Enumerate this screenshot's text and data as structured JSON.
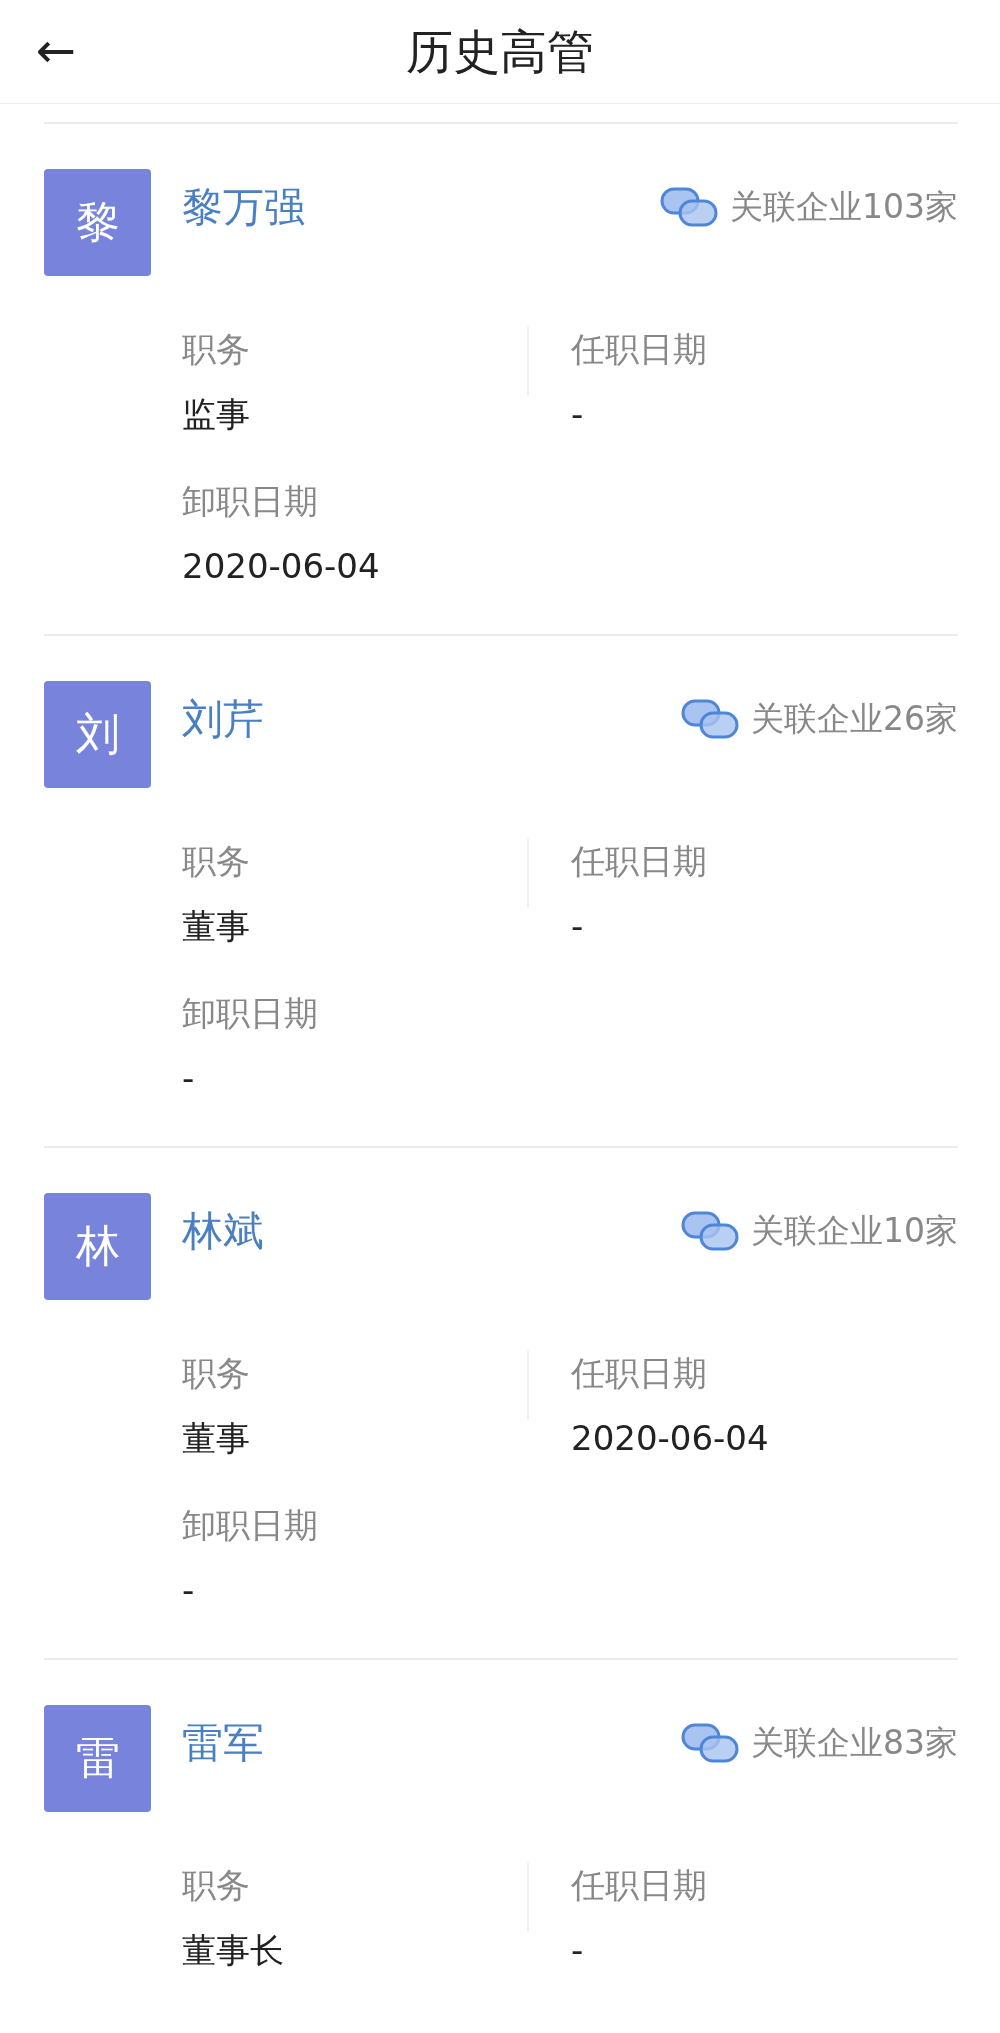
{
  "header": {
    "back": "←",
    "title": "历史高管"
  },
  "people": [
    {
      "avatar": "黎",
      "name": "黎万强",
      "related": "关联企业103家",
      "fields": [
        {
          "label": "职务",
          "value": "监事"
        },
        {
          "label": "任职日期",
          "value": "-"
        },
        {
          "label": "卸职日期",
          "value": "2020-06-04"
        }
      ]
    },
    {
      "avatar": "刘",
      "name": "刘芹",
      "related": "关联企业26家",
      "fields": [
        {
          "label": "职务",
          "value": "董事"
        },
        {
          "label": "任职日期",
          "value": "-"
        },
        {
          "label": "卸职日期",
          "value": "-"
        }
      ]
    },
    {
      "avatar": "林",
      "name": "林斌",
      "related": "关联企业10家",
      "fields": [
        {
          "label": "职务",
          "value": "董事"
        },
        {
          "label": "任职日期",
          "value": "2020-06-04"
        },
        {
          "label": "卸职日期",
          "value": "-"
        }
      ]
    },
    {
      "avatar": "雷",
      "name": "雷军",
      "related": "关联企业83家",
      "fields": [
        {
          "label": "职务",
          "value": "董事长"
        },
        {
          "label": "任职日期",
          "value": "-"
        }
      ]
    }
  ]
}
